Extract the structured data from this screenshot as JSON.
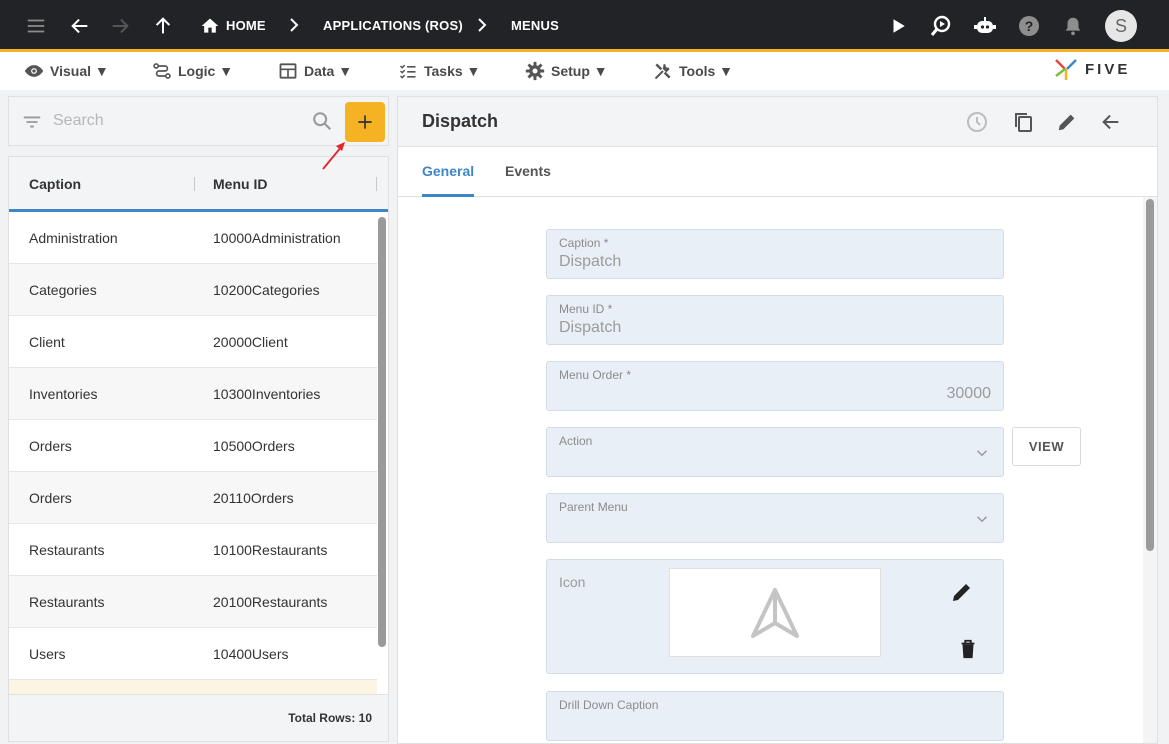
{
  "breadcrumb": {
    "home": "HOME",
    "app": "APPLICATIONS (ROS)",
    "current": "MENUS"
  },
  "user": {
    "initial": "S"
  },
  "menubar": {
    "visual": "Visual ▼",
    "logic": "Logic ▼",
    "data": "Data ▼",
    "tasks": "Tasks ▼",
    "setup": "Setup ▼",
    "tools": "Tools ▼"
  },
  "logo": {
    "text": "FIVE"
  },
  "search": {
    "placeholder": "Search"
  },
  "grid": {
    "columns": [
      "Caption",
      "Menu ID"
    ],
    "rows": [
      {
        "caption": "Administration",
        "menu_id": "10000Administration"
      },
      {
        "caption": "Categories",
        "menu_id": "10200Categories"
      },
      {
        "caption": "Client",
        "menu_id": "20000Client"
      },
      {
        "caption": "Inventories",
        "menu_id": "10300Inventories"
      },
      {
        "caption": "Orders",
        "menu_id": "10500Orders"
      },
      {
        "caption": "Orders",
        "menu_id": "20110Orders"
      },
      {
        "caption": "Restaurants",
        "menu_id": "10100Restaurants"
      },
      {
        "caption": "Restaurants",
        "menu_id": "20100Restaurants"
      },
      {
        "caption": "Users",
        "menu_id": "10400Users"
      }
    ],
    "footer": "Total Rows: 10"
  },
  "form": {
    "title": "Dispatch",
    "tabs": [
      "General",
      "Events"
    ],
    "fields": {
      "caption": {
        "label": "Caption *",
        "value": "Dispatch"
      },
      "menu_id": {
        "label": "Menu ID *",
        "value": "Dispatch"
      },
      "menu_order": {
        "label": "Menu Order *",
        "value": "30000"
      },
      "action": {
        "label": "Action",
        "value": ""
      },
      "parent_menu": {
        "label": "Parent Menu",
        "value": ""
      },
      "icon": {
        "label": "Icon"
      },
      "drill_down_caption": {
        "label": "Drill Down Caption",
        "value": ""
      }
    },
    "view_button": "VIEW"
  },
  "colors": {
    "accent": "#f5b324",
    "primary": "#3f86c9",
    "topbar": "#222326"
  }
}
